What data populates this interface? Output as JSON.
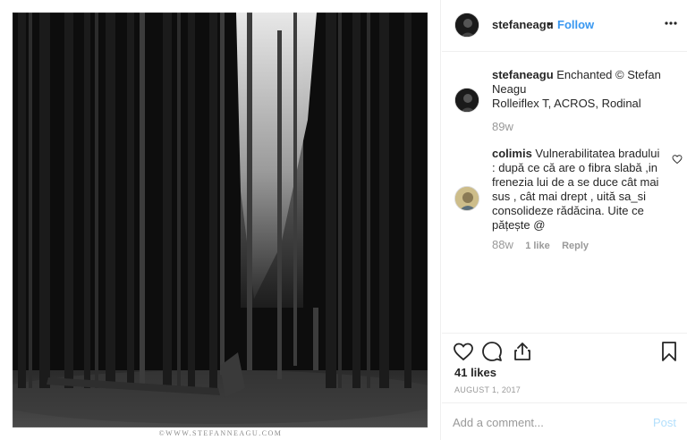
{
  "photo": {
    "alt_icon": "forest-photo",
    "watermark": "©WWW.STEFANNEAGU.COM"
  },
  "header": {
    "username": "stefaneagu",
    "separator": "•",
    "follow_label": "Follow",
    "more_icon": "more-dots-icon"
  },
  "caption": {
    "username": "stefaneagu",
    "text_line1": " Enchanted © Stefan Neagu",
    "text_line2": "Rolleiflex T, ACROS, Rodinal",
    "time": "89w"
  },
  "comment": {
    "username": "colimis",
    "text": " Vulnerabilitatea bradului : după ce că are o fibra slabă ,in frenezia lui de a se duce cât mai sus , cât mai drept , uită sa_si consolideze rădăcina. Uite ce pățește @",
    "time": "88w",
    "likes": "1 like",
    "reply_label": "Reply"
  },
  "actions": {
    "like_icon": "heart-icon",
    "comment_icon": "comment-icon",
    "share_icon": "share-icon",
    "save_icon": "bookmark-icon",
    "likes_count": "41 likes",
    "date": "AUGUST 1, 2017"
  },
  "add_comment": {
    "placeholder": "Add a comment...",
    "post_label": "Post"
  },
  "colors": {
    "accent": "#3897f0",
    "post_disabled": "#b2dffc",
    "muted": "#999999",
    "text": "#262626"
  }
}
